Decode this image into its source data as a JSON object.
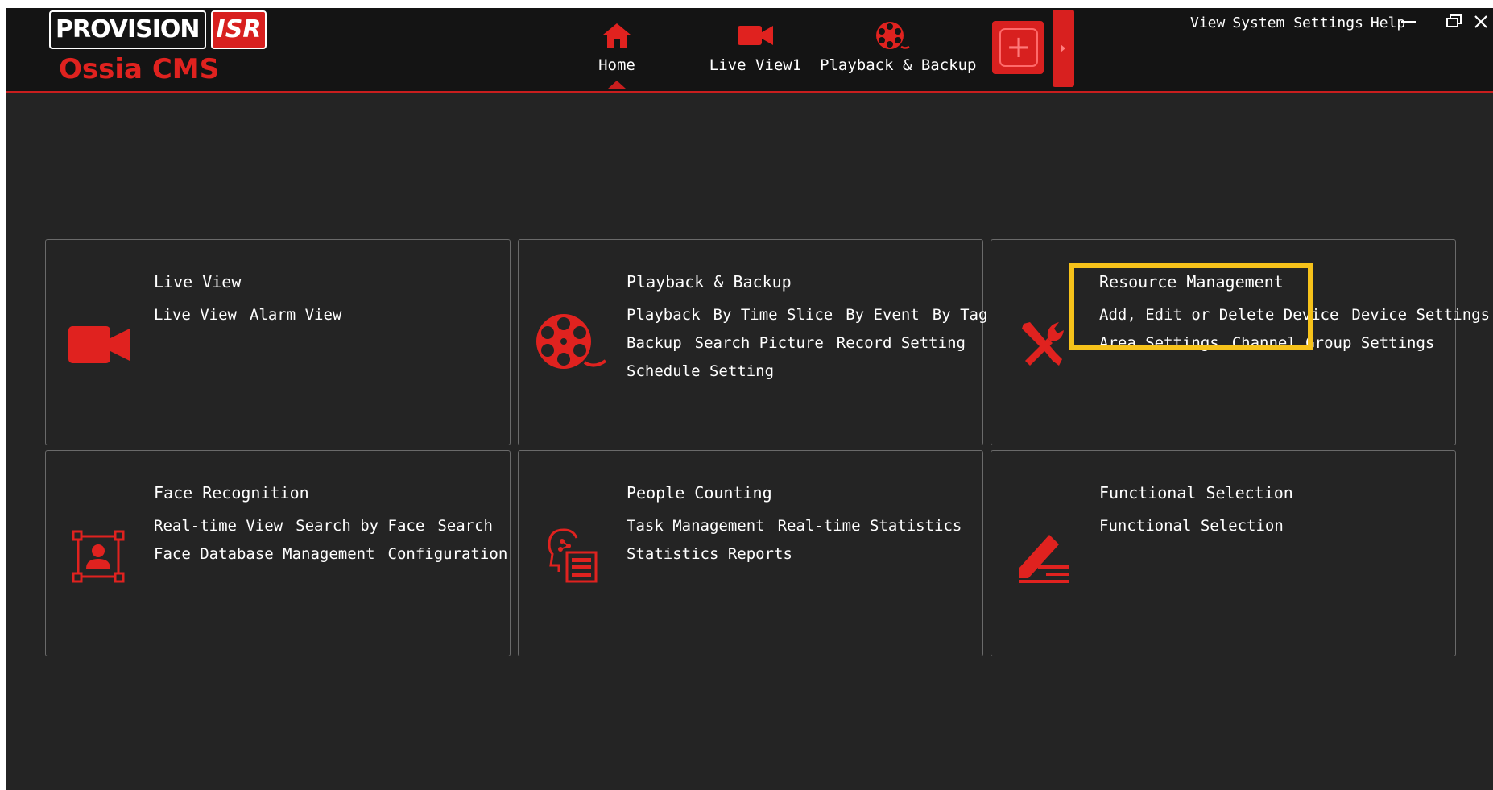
{
  "app": {
    "brand_provision": "PROVISION",
    "brand_isr": "ISR",
    "product_name": "Ossia CMS"
  },
  "nav": {
    "tabs": [
      {
        "label": "Home",
        "icon": "home-icon",
        "active": true
      },
      {
        "label": "Live View1",
        "icon": "video-camera-icon",
        "active": false
      },
      {
        "label": "Playback & Backup",
        "icon": "film-reel-icon",
        "active": false
      }
    ],
    "add_tab_symbol": "+"
  },
  "menu": {
    "view": "View",
    "system_settings": "System Settings",
    "help": "Help"
  },
  "cards": [
    {
      "title": "Live View",
      "icon": "video-camera-icon",
      "rows": [
        [
          "Live View",
          "Alarm View"
        ]
      ]
    },
    {
      "title": "Playback & Backup",
      "icon": "film-reel-icon",
      "rows": [
        [
          "Playback",
          "By Time Slice",
          "By Event",
          "By Tag"
        ],
        [
          "Backup",
          "Search Picture",
          "Record Setting"
        ],
        [
          "Schedule Setting"
        ]
      ]
    },
    {
      "title": "Resource Management",
      "icon": "tools-icon",
      "rows": [
        [
          "Add, Edit or Delete Device",
          "Device Settings"
        ],
        [
          "Area Settings",
          "Channel Group Settings"
        ]
      ]
    },
    {
      "title": "Face Recognition",
      "icon": "face-frame-icon",
      "rows": [
        [
          "Real-time View",
          "Search by Face",
          "Search"
        ],
        [
          "Face Database Management",
          "Configuration"
        ]
      ]
    },
    {
      "title": "People Counting",
      "icon": "people-counting-icon",
      "rows": [
        [
          "Task Management",
          "Real-time Statistics"
        ],
        [
          "Statistics Reports"
        ]
      ]
    },
    {
      "title": "Functional Selection",
      "icon": "edit-list-icon",
      "rows": [
        [
          "Functional Selection"
        ]
      ]
    }
  ],
  "colors": {
    "accent_red": "#d8201f",
    "highlight_yellow": "#f6c21a",
    "background": "#242424",
    "titlebar": "#141414"
  }
}
